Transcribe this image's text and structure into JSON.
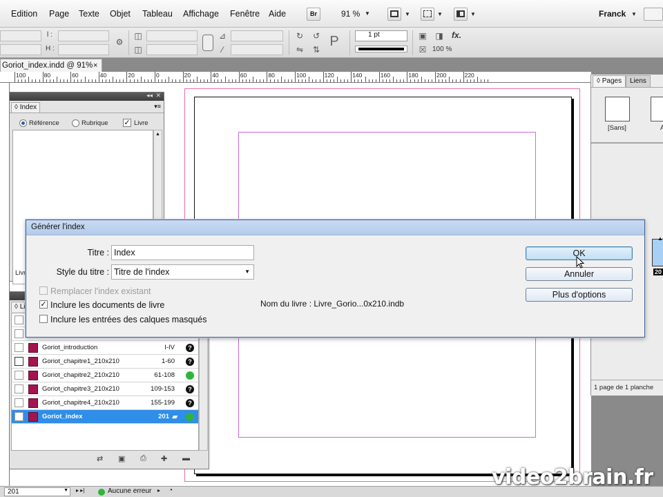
{
  "menubar": {
    "items": [
      "Edition",
      "Page",
      "Texte",
      "Objet",
      "Tableau",
      "Affichage",
      "Fenêtre",
      "Aide"
    ],
    "bridge_label": "Br",
    "zoom": "91 %",
    "workspace": "Franck"
  },
  "control": {
    "l_label": "l :",
    "h_label": "H :",
    "stroke_weight": "1 pt",
    "scale": "100 %",
    "fx_label": "fx."
  },
  "document": {
    "tab_title": "Goriot_index.indd @ 91%",
    "tab_close": "×",
    "ruler_labels": [
      "100",
      "80",
      "60",
      "40",
      "20",
      "0",
      "20",
      "40",
      "60",
      "80",
      "100",
      "120",
      "140",
      "160",
      "180",
      "200",
      "220"
    ]
  },
  "index_panel": {
    "tab": "◊ Index",
    "radio_reference": "Référence",
    "radio_rubrique": "Rubrique",
    "check_livre": "Livre",
    "bottom_label": "Livr"
  },
  "book_panel": {
    "tab": "◊ Li",
    "rows": [
      {
        "name": "Goriot_introduction",
        "pages": "I-IV",
        "status": "?"
      },
      {
        "name": "Goriot_chapitre1_210x210",
        "pages": "1-60",
        "status": "?"
      },
      {
        "name": "Goriot_chapitre2_210x210",
        "pages": "61-108",
        "status": ""
      },
      {
        "name": "Goriot_chapitre3_210x210",
        "pages": "109-153",
        "status": "?"
      },
      {
        "name": "Goriot_chapitre4_210x210",
        "pages": "155-199",
        "status": "?"
      },
      {
        "name": "Goriot_index",
        "pages": "201",
        "status": ""
      }
    ]
  },
  "pages_panel": {
    "tab_pages": "◊ Pages",
    "tab_liens": "Liens",
    "master_none": "[Sans]",
    "master_a": "A",
    "page_badge": "20",
    "footer": "1 page de 1 planche"
  },
  "dialog": {
    "title": "Générer l'index",
    "titre_label": "Titre :",
    "titre_value": "Index",
    "style_label": "Style du titre :",
    "style_value": "Titre de l'index",
    "replace_label": "Remplacer l'index existant",
    "include_book_label": "Inclure les documents de livre",
    "include_hidden_label": "Inclure les entrées des calques masqués",
    "book_name": "Nom du livre : Livre_Gorio...0x210.indb",
    "ok": "OK",
    "cancel": "Annuler",
    "more_options": "Plus d'options"
  },
  "statusbar": {
    "page": "201",
    "error": "Aucune erreur"
  },
  "watermark": "video2brain.fr"
}
